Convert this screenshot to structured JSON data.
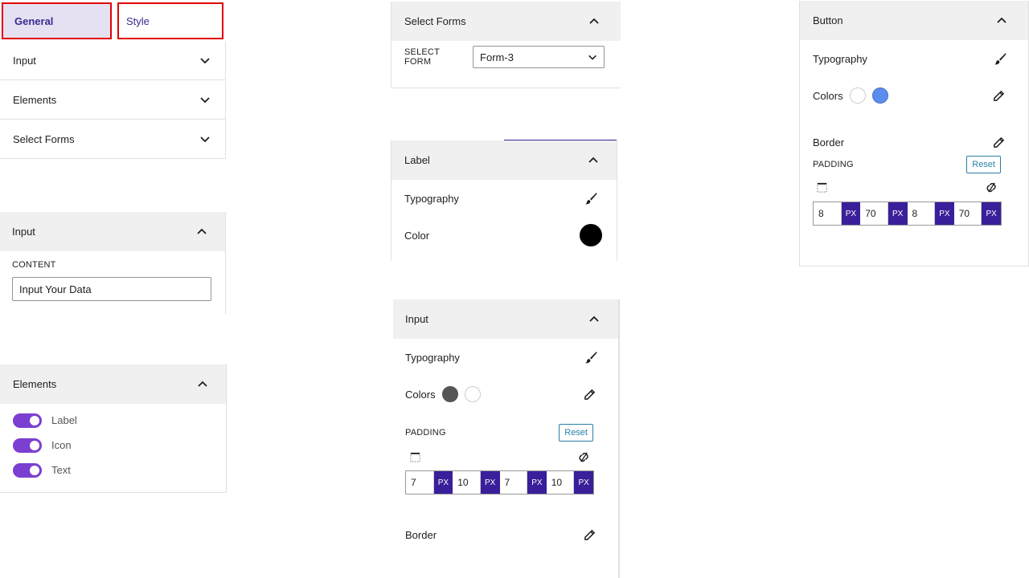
{
  "tabs": {
    "general": "General",
    "style": "Style"
  },
  "left_accordion": [
    {
      "label": "Input"
    },
    {
      "label": "Elements"
    },
    {
      "label": "Select Forms"
    }
  ],
  "input_panel": {
    "title": "Input",
    "content_label": "CONTENT",
    "content_value": "Input Your Data"
  },
  "elements_panel": {
    "title": "Elements",
    "toggles": [
      {
        "label": "Label",
        "on": true
      },
      {
        "label": "Icon",
        "on": true
      },
      {
        "label": "Text",
        "on": true
      }
    ]
  },
  "select_forms_panel": {
    "title": "Select Forms",
    "field_label": "SELECT FORM",
    "selected": "Form-3"
  },
  "label_panel": {
    "title": "Label",
    "typography": "Typography",
    "color": "Color",
    "color_value": "#000000"
  },
  "style_input_panel": {
    "title": "Input",
    "typography": "Typography",
    "colors": "Colors",
    "color_values": [
      "#555555",
      "#ffffff"
    ],
    "padding_label": "PADDING",
    "reset": "Reset",
    "padding": [
      {
        "value": "7",
        "unit": "PX"
      },
      {
        "value": "10",
        "unit": "PX"
      },
      {
        "value": "7",
        "unit": "PX"
      },
      {
        "value": "10",
        "unit": "PX"
      }
    ],
    "border": "Border"
  },
  "button_panel": {
    "title": "Button",
    "typography": "Typography",
    "colors": "Colors",
    "color_values": [
      "#ffffff",
      "#5b8def"
    ],
    "border": "Border",
    "padding_label": "PADDING",
    "reset": "Reset",
    "padding": [
      {
        "value": "8",
        "unit": "PX"
      },
      {
        "value": "70",
        "unit": "PX"
      },
      {
        "value": "8",
        "unit": "PX"
      },
      {
        "value": "70",
        "unit": "PX"
      }
    ]
  },
  "colors": {
    "accent": "#3a1f9a",
    "toggle": "#7b3fd1",
    "highlight_border": "#e00000"
  }
}
